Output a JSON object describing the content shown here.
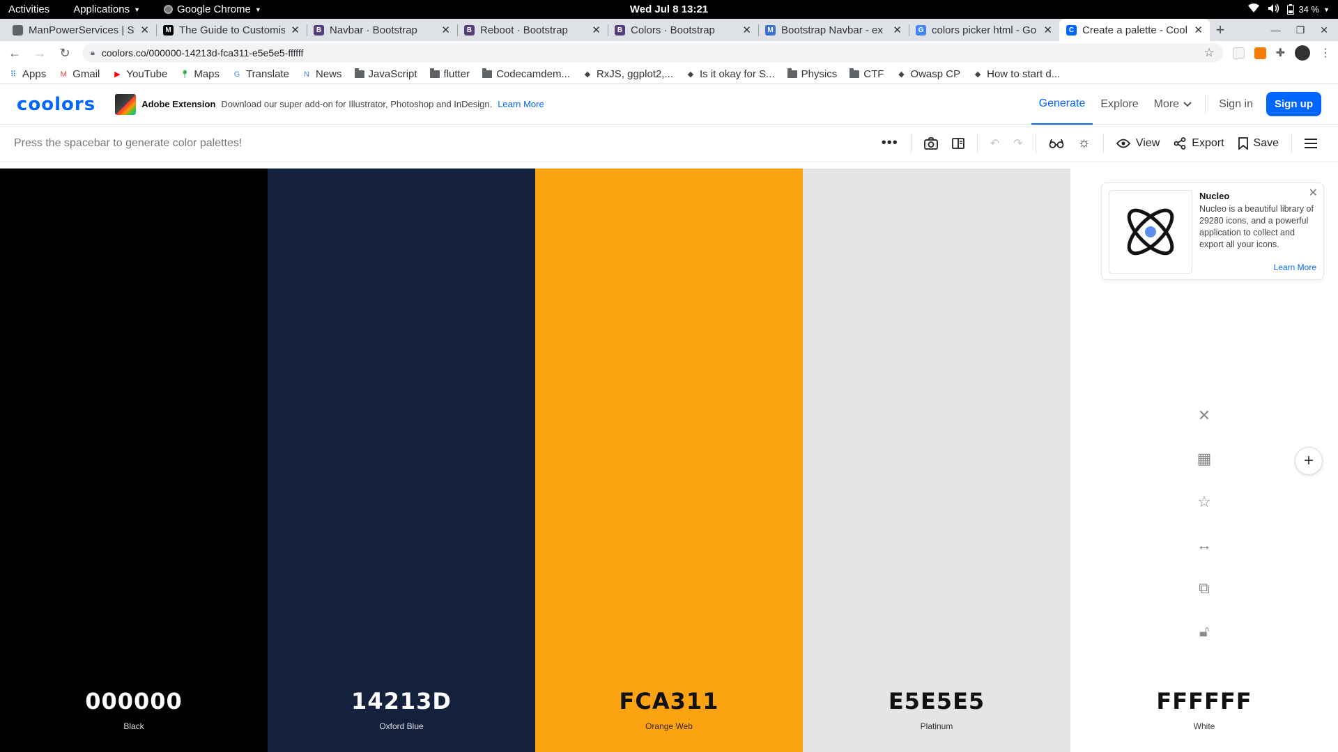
{
  "system": {
    "activities": "Activities",
    "applications": "Applications",
    "browser_name": "Google Chrome",
    "clock": "Wed Jul 8  13:21",
    "battery": "34 %"
  },
  "tabs": [
    {
      "title": "ManPowerServices | St",
      "favicon_color": "#5f6368",
      "favicon_letter": ""
    },
    {
      "title": "The Guide to Customis",
      "favicon_color": "#000000",
      "favicon_letter": "M"
    },
    {
      "title": "Navbar · Bootstrap",
      "favicon_color": "#563d7c",
      "favicon_letter": "B"
    },
    {
      "title": "Reboot · Bootstrap",
      "favicon_color": "#563d7c",
      "favicon_letter": "B"
    },
    {
      "title": "Colors · Bootstrap",
      "favicon_color": "#563d7c",
      "favicon_letter": "B"
    },
    {
      "title": "Bootstrap Navbar - ex",
      "favicon_color": "#3b71ca",
      "favicon_letter": "M"
    },
    {
      "title": "colors picker html - Go",
      "favicon_color": "#4285f4",
      "favicon_letter": "G"
    },
    {
      "title": "Create a palette - Cool",
      "favicon_color": "#0066ff",
      "favicon_letter": "C"
    }
  ],
  "url": "coolors.co/000000-14213d-fca311-e5e5e5-ffffff",
  "bookmarks": [
    {
      "label": "Apps",
      "type": "apps"
    },
    {
      "label": "Gmail",
      "type": "gmail"
    },
    {
      "label": "YouTube",
      "type": "youtube"
    },
    {
      "label": "Maps",
      "type": "maps"
    },
    {
      "label": "Translate",
      "type": "translate"
    },
    {
      "label": "News",
      "type": "news"
    },
    {
      "label": "JavaScript",
      "type": "folder"
    },
    {
      "label": "flutter",
      "type": "folder"
    },
    {
      "label": "Codecamdem...",
      "type": "folder"
    },
    {
      "label": "RxJS, ggplot2,...",
      "type": "site"
    },
    {
      "label": "Is it okay for S...",
      "type": "site"
    },
    {
      "label": "Physics",
      "type": "folder"
    },
    {
      "label": "CTF",
      "type": "folder"
    },
    {
      "label": "Owasp CP",
      "type": "site"
    },
    {
      "label": "How to start d...",
      "type": "site"
    }
  ],
  "header": {
    "logo": "coolors",
    "promo_name": "Adobe Extension",
    "promo_desc": "Download our super add-on for Illustrator, Photoshop and InDesign.",
    "promo_link": "Learn More",
    "nav_generate": "Generate",
    "nav_explore": "Explore",
    "nav_more": "More",
    "sign_in": "Sign in",
    "sign_up": "Sign up"
  },
  "toolbar": {
    "hint": "Press the spacebar to generate color palettes!",
    "view": "View",
    "export": "Export",
    "save": "Save"
  },
  "palette": [
    {
      "hex": "000000",
      "name": "Black",
      "color": "#000000",
      "text": "#ffffff"
    },
    {
      "hex": "14213D",
      "name": "Oxford Blue",
      "color": "#14213d",
      "text": "#ffffff"
    },
    {
      "hex": "FCA311",
      "name": "Orange Web",
      "color": "#fca311",
      "text": "#111111"
    },
    {
      "hex": "E5E5E5",
      "name": "Platinum",
      "color": "#e5e5e5",
      "text": "#111111"
    },
    {
      "hex": "FFFFFF",
      "name": "White",
      "color": "#ffffff",
      "text": "#111111"
    }
  ],
  "ad": {
    "title": "Nucleo",
    "body": "Nucleo is a beautiful library of 29280 icons, and a powerful application to collect and export all your icons.",
    "link": "Learn More"
  }
}
